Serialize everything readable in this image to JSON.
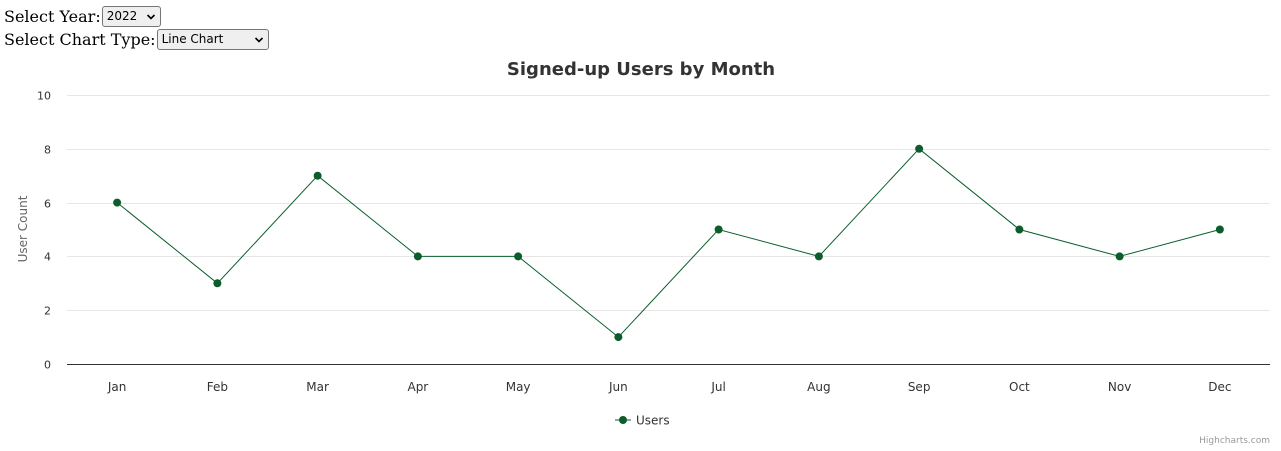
{
  "controls": {
    "year_label": "Select Year:",
    "year_value": "2022",
    "type_label": "Select Chart Type:",
    "type_value": "Line Chart"
  },
  "colors": {
    "series": "#0b5e2b",
    "grid": "#e6e6e6",
    "axis_line": "#333333",
    "text": "#333333",
    "title": "#333333",
    "credits": "#999999"
  },
  "chart_data": {
    "type": "line",
    "title": "Signed-up Users by Month",
    "xlabel": "",
    "ylabel": "User Count",
    "categories": [
      "Jan",
      "Feb",
      "Mar",
      "Apr",
      "May",
      "Jun",
      "Jul",
      "Aug",
      "Sep",
      "Oct",
      "Nov",
      "Dec"
    ],
    "series": [
      {
        "name": "Users",
        "values": [
          6,
          3,
          7,
          4,
          4,
          1,
          5,
          4,
          8,
          5,
          4,
          5
        ]
      }
    ],
    "ylim": [
      0,
      10
    ],
    "yticks": [
      0,
      2,
      4,
      6,
      8,
      10
    ],
    "grid": true,
    "legend": "bottom-center"
  },
  "credits": "Highcharts.com"
}
